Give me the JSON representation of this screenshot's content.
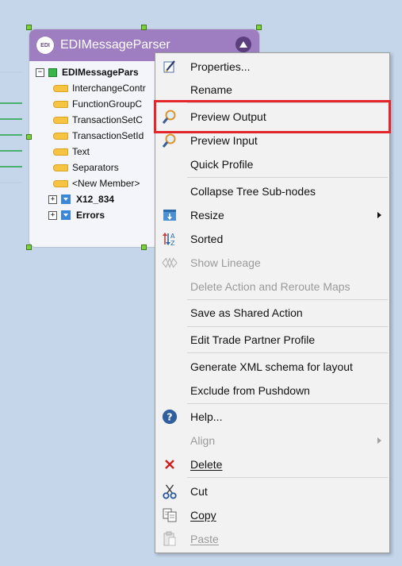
{
  "node": {
    "logo_text": "EDI",
    "title": "EDIMessageParser",
    "tree": [
      {
        "kind": "root",
        "label": "EDIMessagePars"
      },
      {
        "kind": "field",
        "label": "InterchangeContr"
      },
      {
        "kind": "field",
        "label": "FunctionGroupC"
      },
      {
        "kind": "field",
        "label": "TransactionSetC"
      },
      {
        "kind": "field",
        "label": "TransactionSetId"
      },
      {
        "kind": "field",
        "label": "Text"
      },
      {
        "kind": "field",
        "label": "Separators"
      },
      {
        "kind": "field",
        "label": "<New Member>"
      },
      {
        "kind": "group",
        "label": "X12_834"
      },
      {
        "kind": "group",
        "label": "Errors"
      }
    ]
  },
  "menu": {
    "items": [
      {
        "label": "Properties...",
        "icon": "pencil-icon"
      },
      {
        "label": "Rename"
      },
      {
        "label": "Preview Output",
        "icon": "magnifier-icon"
      },
      {
        "label": "Preview Input",
        "icon": "magnifier-icon"
      },
      {
        "label": "Quick Profile"
      },
      {
        "label": "Collapse Tree Sub-nodes"
      },
      {
        "label": "Resize",
        "icon": "resize-icon",
        "submenu": true
      },
      {
        "label": "Sorted",
        "icon": "sort-icon"
      },
      {
        "label": "Show Lineage",
        "icon": "lineage-icon",
        "disabled": true
      },
      {
        "label": "Delete Action and Reroute Maps",
        "disabled": true
      },
      {
        "label": "Save as Shared Action"
      },
      {
        "label": "Edit Trade Partner Profile"
      },
      {
        "label": "Generate XML schema for layout"
      },
      {
        "label": "Exclude from Pushdown"
      },
      {
        "label": "Help...",
        "icon": "help-icon"
      },
      {
        "label": "Align",
        "disabled": true,
        "submenu": true
      },
      {
        "label": "Delete",
        "icon": "delete-icon"
      },
      {
        "label": "Cut",
        "icon": "scissors-icon"
      },
      {
        "label": "Copy",
        "icon": "copy-icon"
      },
      {
        "label": "Paste",
        "icon": "paste-icon",
        "disabled": true
      }
    ],
    "highlighted": "Preview Output"
  },
  "colors": {
    "header": "#9e7ec0",
    "highlight_border": "#e3262b",
    "background": "#c5d6ea"
  }
}
